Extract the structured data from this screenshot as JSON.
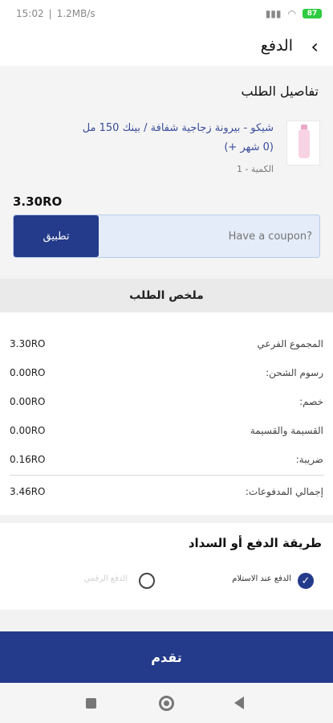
{
  "status_bar": {
    "time": "15:02",
    "network_speed": "1.2MB/s",
    "battery": "87"
  },
  "header": {
    "title": "الدفع",
    "back_icon": "chevron-left-icon"
  },
  "order_details": {
    "section_title": "تفاصيل الطلب",
    "product": {
      "name": "شيكو - بيرونة زجاجية شفافة / بينك 150 مل (0 شهر +)",
      "quantity": "الكمية - 1",
      "price": "3.30RO"
    }
  },
  "coupon": {
    "placeholder": "Have a coupon?",
    "apply_label": "تطبيق"
  },
  "summary": {
    "title": "ملخص الطلب",
    "rows": [
      {
        "label": "المجموع الفرعي",
        "value": "3.30RO"
      },
      {
        "label": "رسوم الشحن:",
        "value": "0.00RO"
      },
      {
        "label": "خصم:",
        "value": "0.00RO"
      },
      {
        "label": "القسيمة والقسيمة",
        "value": "0.00RO"
      },
      {
        "label": "ضريبة:",
        "value": "0.16RO"
      },
      {
        "label": "إجمالي المدفوعات:",
        "value": "3.46RO"
      }
    ]
  },
  "payment": {
    "title": "طريقة الدفع أو السداد",
    "options": [
      {
        "label": "الدفع عند الاستلام",
        "selected": true
      },
      {
        "label": "الدفع الرقمي",
        "selected": false
      }
    ]
  },
  "proceed_label": "تقدم",
  "colors": {
    "primary": "#243a8a",
    "coupon_bg": "#e3ecf8",
    "link": "#3a4d9a"
  }
}
